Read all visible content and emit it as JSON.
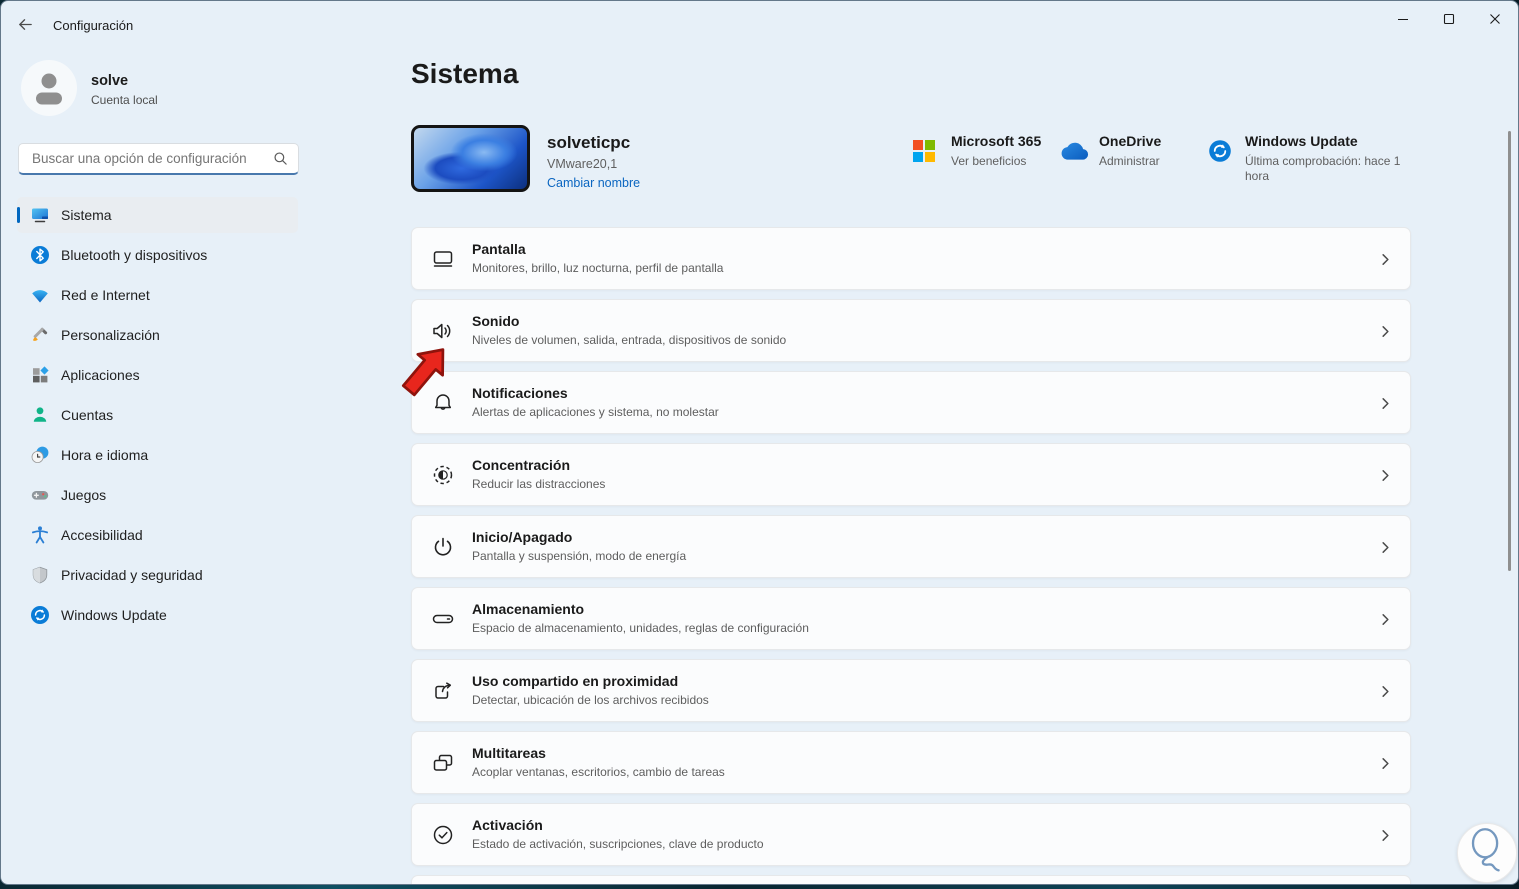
{
  "colors": {
    "accent": "#0067c0",
    "link": "#0b66c1",
    "arrow_red": "#e8261d",
    "window_bg": "#e7f0f8",
    "card_bg": "#fbfcfd"
  },
  "titlebar": {
    "title": "Configuración"
  },
  "account": {
    "name": "solve",
    "type": "Cuenta local"
  },
  "search": {
    "placeholder": "Buscar una opción de configuración"
  },
  "sidebar": {
    "items": [
      {
        "label": "Sistema",
        "icon": "system-icon",
        "selected": true
      },
      {
        "label": "Bluetooth y dispositivos",
        "icon": "bluetooth-icon",
        "selected": false
      },
      {
        "label": "Red e Internet",
        "icon": "network-icon",
        "selected": false
      },
      {
        "label": "Personalización",
        "icon": "personalization-icon",
        "selected": false
      },
      {
        "label": "Aplicaciones",
        "icon": "apps-icon",
        "selected": false
      },
      {
        "label": "Cuentas",
        "icon": "accounts-icon",
        "selected": false
      },
      {
        "label": "Hora e idioma",
        "icon": "time-language-icon",
        "selected": false
      },
      {
        "label": "Juegos",
        "icon": "gaming-icon",
        "selected": false
      },
      {
        "label": "Accesibilidad",
        "icon": "accessibility-icon",
        "selected": false
      },
      {
        "label": "Privacidad y seguridad",
        "icon": "privacy-icon",
        "selected": false
      },
      {
        "label": "Windows Update",
        "icon": "windows-update-icon",
        "selected": false
      }
    ]
  },
  "main": {
    "title": "Sistema",
    "device": {
      "name": "solveticpc",
      "model": "VMware20,1",
      "rename_link": "Cambiar nombre"
    },
    "quick": [
      {
        "title": "Microsoft 365",
        "subtitle": "Ver beneficios",
        "icon": "microsoft-logo"
      },
      {
        "title": "OneDrive",
        "subtitle": "Administrar",
        "icon": "onedrive-icon"
      },
      {
        "title": "Windows Update",
        "subtitle": "Última comprobación: hace 1 hora",
        "icon": "windows-update-icon"
      }
    ],
    "rows": [
      {
        "title": "Pantalla",
        "subtitle": "Monitores, brillo, luz nocturna, perfil de pantalla",
        "icon": "display-icon"
      },
      {
        "title": "Sonido",
        "subtitle": "Niveles de volumen, salida, entrada, dispositivos de sonido",
        "icon": "sound-icon"
      },
      {
        "title": "Notificaciones",
        "subtitle": "Alertas de aplicaciones y sistema, no molestar",
        "icon": "notifications-icon"
      },
      {
        "title": "Concentración",
        "subtitle": "Reducir las distracciones",
        "icon": "focus-icon"
      },
      {
        "title": "Inicio/Apagado",
        "subtitle": "Pantalla y suspensión, modo de energía",
        "icon": "power-icon"
      },
      {
        "title": "Almacenamiento",
        "subtitle": "Espacio de almacenamiento, unidades, reglas de configuración",
        "icon": "storage-icon"
      },
      {
        "title": "Uso compartido en proximidad",
        "subtitle": "Detectar, ubicación de los archivos recibidos",
        "icon": "nearby-sharing-icon"
      },
      {
        "title": "Multitareas",
        "subtitle": "Acoplar ventanas, escritorios, cambio de tareas",
        "icon": "multitasking-icon"
      },
      {
        "title": "Activación",
        "subtitle": "Estado de activación, suscripciones, clave de producto",
        "icon": "activation-icon"
      }
    ]
  }
}
